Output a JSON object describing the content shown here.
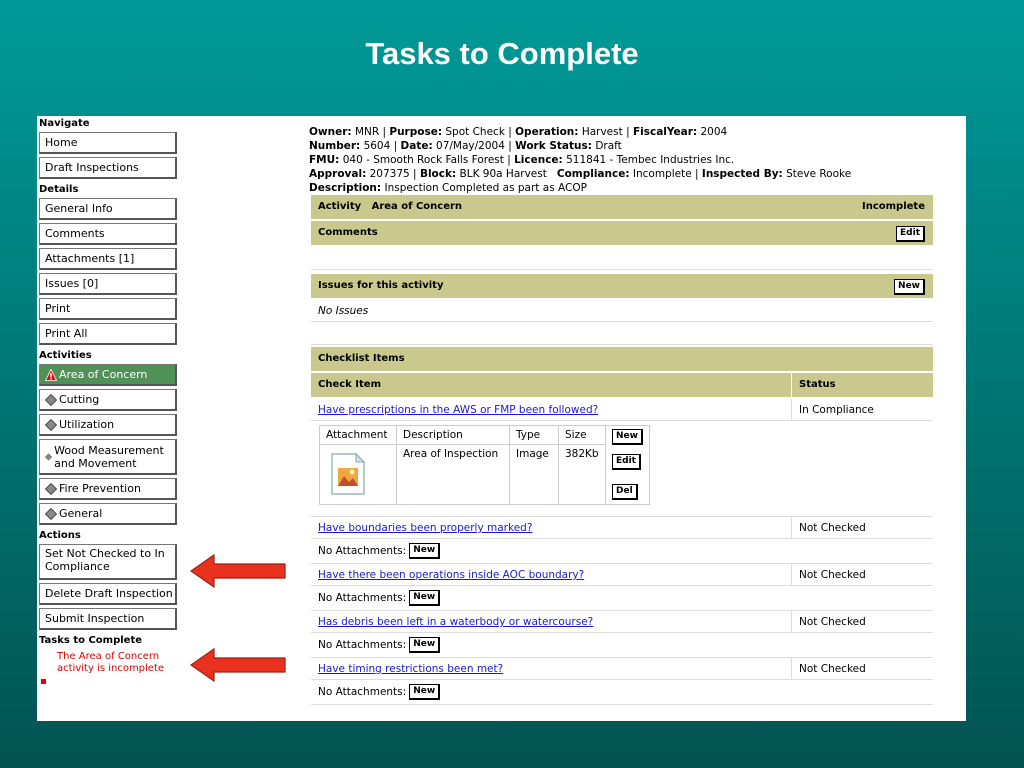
{
  "slide": {
    "title": "Tasks to Complete"
  },
  "sidebar": {
    "navigate_heading": "Navigate",
    "navigate": [
      "Home",
      "Draft Inspections"
    ],
    "details_heading": "Details",
    "details": [
      "General Info",
      "Comments",
      "Attachments [1]",
      "Issues [0]",
      "Print",
      "Print All"
    ],
    "activities_heading": "Activities",
    "activities": [
      "Area of Concern",
      "Cutting",
      "Utilization",
      "Wood Measurement and Movement",
      "Fire Prevention",
      "General"
    ],
    "actions_heading": "Actions",
    "actions": [
      "Set Not Checked to In Compliance",
      "Delete Draft Inspection",
      "Submit Inspection"
    ],
    "tasks_heading": "Tasks to Complete",
    "tasks": [
      "The Area of Concern activity is incomplete"
    ]
  },
  "info": {
    "owner_label": "Owner:",
    "owner": "MNR",
    "purpose_label": "Purpose:",
    "purpose": "Spot Check",
    "operation_label": "Operation:",
    "operation": "Harvest",
    "fiscal_label": "FiscalYear:",
    "fiscal": "2004",
    "number_label": "Number:",
    "number": "5604",
    "date_label": "Date:",
    "date": "07/May/2004",
    "work_status_label": "Work Status:",
    "work_status": "Draft",
    "fmu_label": "FMU:",
    "fmu": "040 - Smooth Rock Falls Forest",
    "licence_label": "Licence:",
    "licence": "511841 - Tembec Industries Inc.",
    "approval_label": "Approval:",
    "approval": "207375",
    "block_label": "Block:",
    "block": "BLK 90a Harvest",
    "compliance_label": "Compliance:",
    "compliance": "Incomplete",
    "inspected_label": "Inspected By:",
    "inspected": "Steve Rooke",
    "description_label": "Description:",
    "description": "Inspection Completed as part as ACOP"
  },
  "activity_bar": {
    "label": "Activity",
    "name": "Area of Concern",
    "status": "Incomplete"
  },
  "comments_bar": {
    "label": "Comments",
    "edit": "Edit"
  },
  "issues_bar": {
    "label": "Issues for this activity",
    "new": "New",
    "none": "No Issues"
  },
  "checklist": {
    "title": "Checklist Items",
    "col_item": "Check Item",
    "col_status": "Status",
    "items": [
      {
        "question": "Have prescriptions in the AWS or FMP been followed?",
        "status": "In Compliance"
      },
      {
        "question": "Have boundaries been properly marked?",
        "status": "Not Checked"
      },
      {
        "question": "Have there been operations inside AOC boundary?",
        "status": "Not Checked"
      },
      {
        "question": "Has debris been left in a waterbody or watercourse?",
        "status": "Not Checked"
      },
      {
        "question": "Have timing restrictions been met?",
        "status": "Not Checked"
      }
    ],
    "no_attachments": "No Attachments:",
    "new": "New"
  },
  "attachment_table": {
    "headers": [
      "Attachment",
      "Description",
      "Type",
      "Size"
    ],
    "row": {
      "description": "Area of Inspection",
      "type": "Image",
      "size": "382Kb"
    },
    "new": "New",
    "edit": "Edit",
    "del": "Del"
  },
  "colors": {
    "accent_bar": "#c9c98d",
    "active_activity": "#4f9156",
    "arrow": "#e8321e",
    "task_text": "#e00000"
  }
}
